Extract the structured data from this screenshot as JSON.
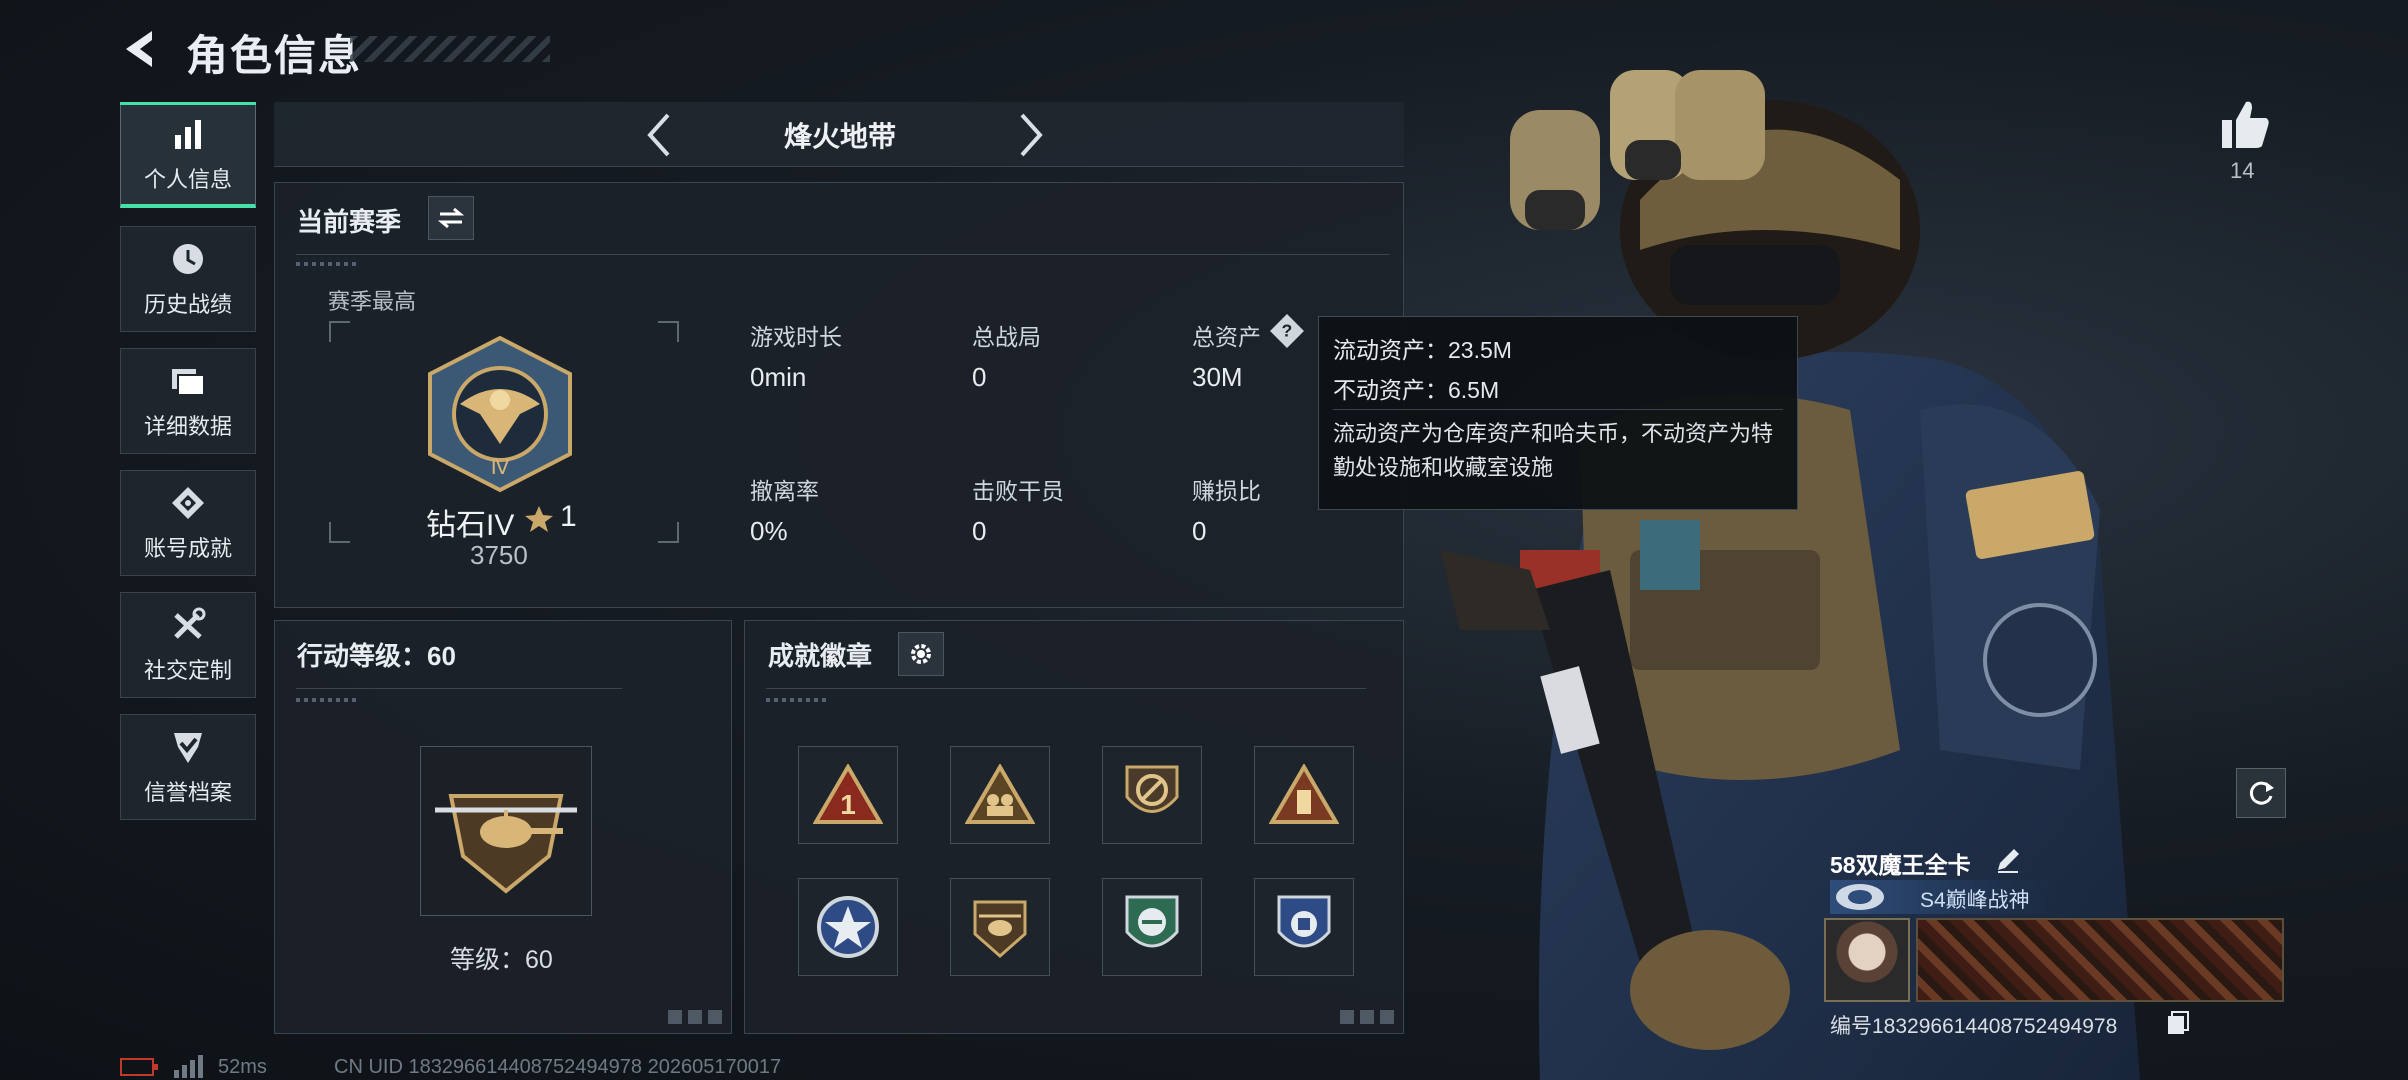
{
  "header": {
    "title": "角色信息"
  },
  "sidebar": {
    "items": [
      {
        "label": "个人信息",
        "icon": "bar-chart-icon",
        "active": true
      },
      {
        "label": "历史战绩",
        "icon": "clock-icon",
        "active": false
      },
      {
        "label": "详细数据",
        "icon": "folder-icon",
        "active": false
      },
      {
        "label": "账号成就",
        "icon": "achievement-icon",
        "active": false
      },
      {
        "label": "社交定制",
        "icon": "tools-icon",
        "active": false
      },
      {
        "label": "信誉档案",
        "icon": "shield-check-icon",
        "active": false
      }
    ]
  },
  "mode": {
    "title": "烽火地带"
  },
  "season": {
    "title": "当前赛季",
    "best_label": "赛季最高",
    "rank_name": "钻石IV",
    "rank_stars": "1",
    "rank_points": "3750",
    "stats": [
      {
        "label": "游戏时长",
        "value": "0min"
      },
      {
        "label": "总战局",
        "value": "0"
      },
      {
        "label": "总资产",
        "value": "30M"
      },
      {
        "label": "撤离率",
        "value": "0%"
      },
      {
        "label": "击败干员",
        "value": "0"
      },
      {
        "label": "赚损比",
        "value": "0"
      }
    ]
  },
  "tooltip": {
    "liquid": "流动资产：23.5M",
    "fixed": "不动资产：6.5M",
    "desc": "流动资产为仓库资产和哈夫币，不动资产为特勤处设施和收藏室设施"
  },
  "action_level": {
    "title": "行动等级：60",
    "level_text": "等级：60"
  },
  "achievements": {
    "title": "成就徽章"
  },
  "profile": {
    "likes": "14",
    "player_name": "58双魔王全卡",
    "player_title": "S4巅峰战神",
    "player_id": "编号18329661440875249497​8"
  },
  "status_bar": {
    "ping": "52ms",
    "uid": "CN UID 18329661440875249497​8 202605170017"
  },
  "colors": {
    "accent": "#47e0a6",
    "gold": "#c9a86a"
  }
}
